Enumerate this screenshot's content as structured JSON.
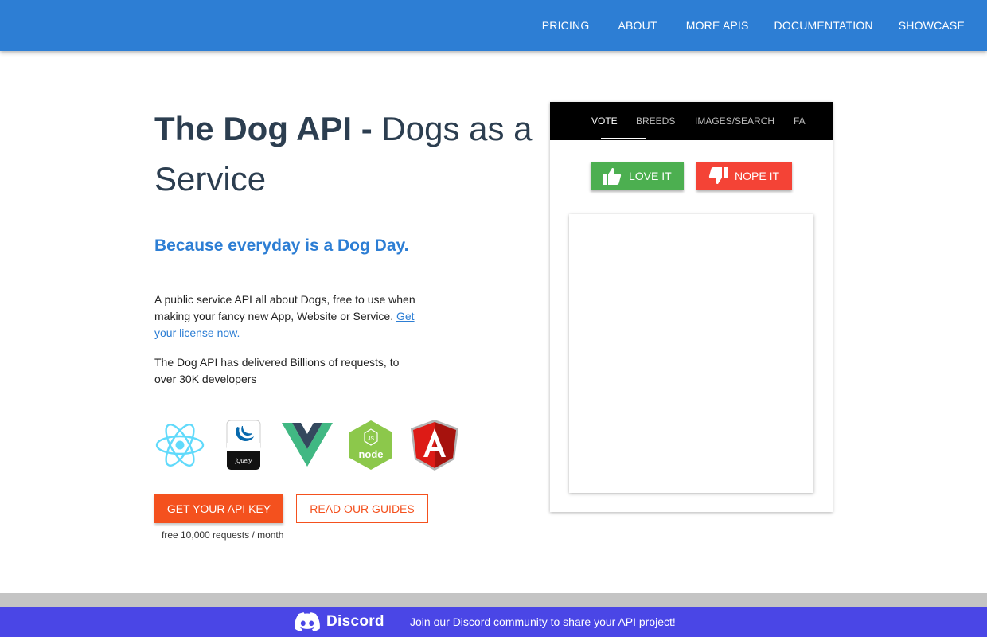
{
  "nav": {
    "items": [
      "PRICING",
      "ABOUT",
      "MORE APIS",
      "DOCUMENTATION",
      "SHOWCASE"
    ]
  },
  "hero": {
    "title_bold": "The Dog API -",
    "title_rest": " Dogs as a Service",
    "tagline": "Because everyday is a Dog Day.",
    "description": "A public service API all about Dogs, free to use when making your fancy new App, Website or Service. ",
    "license_link": "Get your license now.",
    "stats": "The Dog API has delivered Billions of requests, to over 30K developers",
    "logos": [
      "react-logo",
      "jquery-logo",
      "vue-logo",
      "nodejs-logo",
      "angular-logo"
    ],
    "api_key_button": "GET YOUR API KEY",
    "guides_button": "READ OUR GUIDES",
    "free_note": "free 10,000 requests / month"
  },
  "panel": {
    "tabs": [
      "VOTE",
      "BREEDS",
      "IMAGES/SEARCH",
      "FA"
    ],
    "active_tab": "VOTE",
    "love_button": "LOVE IT",
    "nope_button": "NOPE IT"
  },
  "footer": {
    "discord_word": "Discord",
    "discord_link": "Join our Discord community to share your API project!"
  },
  "colors": {
    "nav_bg": "#2d7ed4",
    "accent_orange": "#f4511e",
    "love_green": "#4caf50",
    "nope_red": "#f44336",
    "discord_purple": "#4a46e6"
  }
}
